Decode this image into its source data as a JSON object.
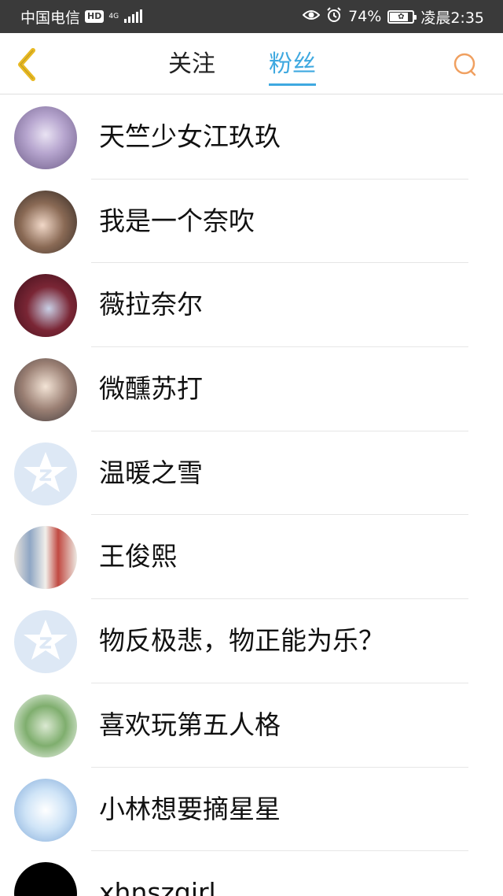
{
  "status_bar": {
    "carrier": "中国电信",
    "hd": "HD",
    "network": "4G",
    "battery": "74%",
    "time": "凌晨2:35",
    "icons": [
      "eye-icon",
      "alarm-icon",
      "battery-icon",
      "signal-icon"
    ]
  },
  "header": {
    "back_icon": "chevron-left-icon",
    "tabs": [
      {
        "label": "关注",
        "active": false
      },
      {
        "label": "粉丝",
        "active": true
      }
    ],
    "search_icon": "search-icon"
  },
  "colors": {
    "accent": "#3fa9e0",
    "back": "#e8b923",
    "search": "#f0a060",
    "status_bar": "#3a3a3a"
  },
  "fans": [
    {
      "name": "天竺少女江玖玖"
    },
    {
      "name": "我是一个奈吹"
    },
    {
      "name": "薇拉奈尔"
    },
    {
      "name": "微醺苏打"
    },
    {
      "name": "温暖之雪"
    },
    {
      "name": "王俊熙"
    },
    {
      "name": "物反极悲，物正能为乐？"
    },
    {
      "name": "喜欢玩第五人格"
    },
    {
      "name": "小林想要摘星星"
    },
    {
      "name": "xhnszgirl"
    }
  ]
}
